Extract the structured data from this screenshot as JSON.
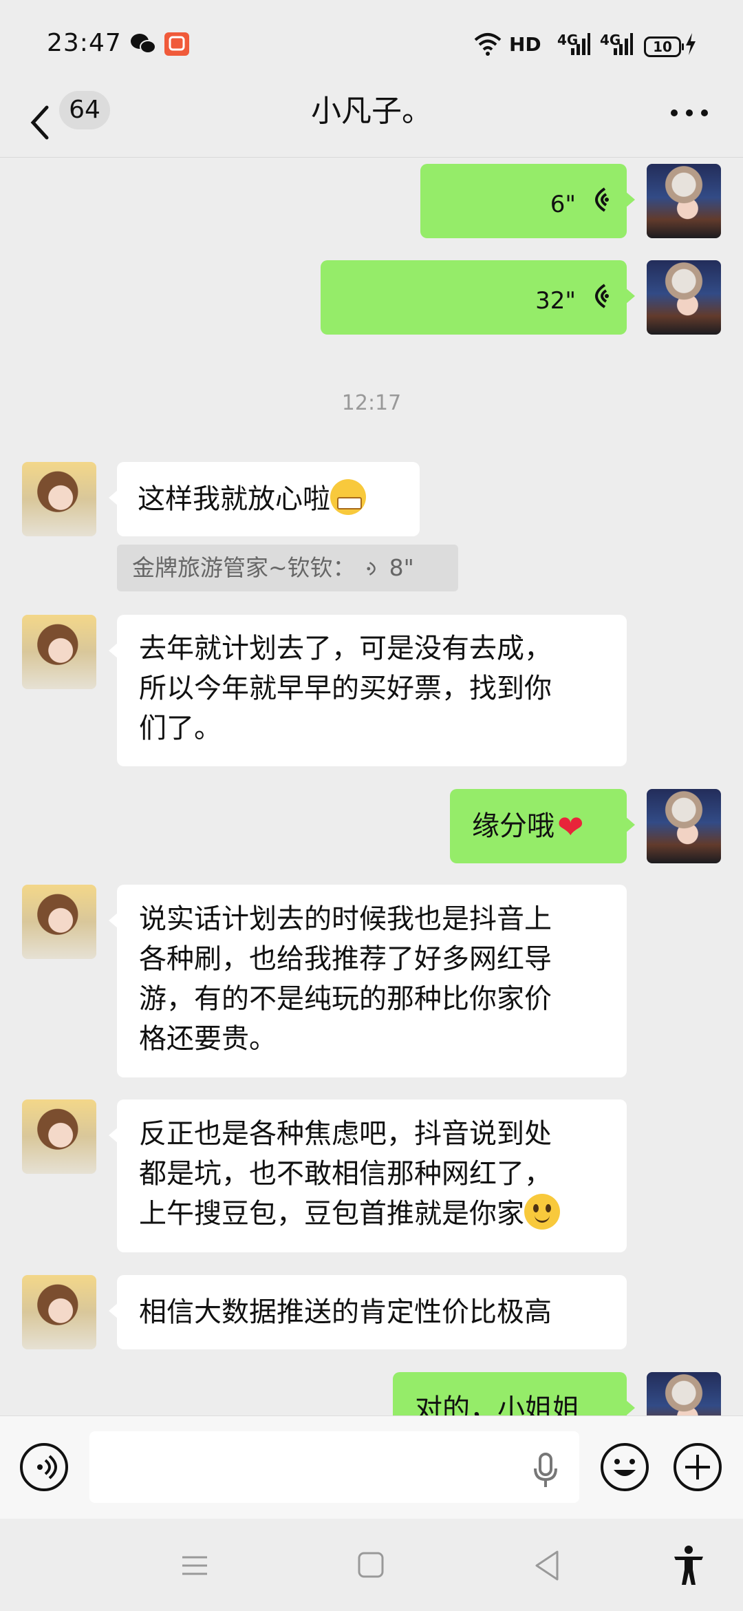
{
  "status_bar": {
    "time": "23:47",
    "network_label": "HD",
    "sim1_label": "4G",
    "sim2_label": "4G",
    "battery": "10",
    "icons": [
      "wechat-icon",
      "app-notification-icon",
      "wifi-icon",
      "signal-icon",
      "charging-icon"
    ]
  },
  "header": {
    "unread_count": "64",
    "title": "小凡子。",
    "icons": [
      "back-chevron-icon",
      "more-icon"
    ]
  },
  "messages": [
    {
      "sender": "me",
      "type": "voice",
      "duration": "6\""
    },
    {
      "sender": "me",
      "type": "voice",
      "duration": "32\""
    },
    {
      "type": "timestamp",
      "text": "12:17"
    },
    {
      "sender": "other",
      "type": "text",
      "text": "这样我就放心啦",
      "emoji": "grin-emoji"
    },
    {
      "type": "quote",
      "text": "金牌旅游管家~钦钦：",
      "duration": "8\""
    },
    {
      "sender": "other",
      "type": "text",
      "lines": [
        "去年就计划去了，可是没有去成，",
        "所以今年就早早的买好票，找到你",
        "们了。"
      ]
    },
    {
      "sender": "me",
      "type": "text",
      "text": "缘分哦",
      "emoji": "heart-emoji"
    },
    {
      "sender": "other",
      "type": "text",
      "lines": [
        "说实话计划去的时候我也是抖音上",
        "各种刷，也给我推荐了好多网红导",
        "游，有的不是纯玩的那种比你家价",
        "格还要贵。"
      ]
    },
    {
      "sender": "other",
      "type": "text",
      "lines": [
        "反正也是各种焦虑吧，抖音说到处",
        "都是坑，也不敢相信那种网红了，",
        "上午搜豆包，豆包首推就是你家"
      ],
      "emoji": "smile-emoji"
    },
    {
      "sender": "other",
      "type": "text",
      "text": "相信大数据推送的肯定性价比极高"
    },
    {
      "sender": "me",
      "type": "text",
      "text": "对的，小姐姐"
    }
  ],
  "input_bar": {
    "value": "",
    "icons": [
      "voice-mode-icon",
      "microphone-icon",
      "emoji-icon",
      "plus-icon"
    ]
  },
  "nav_bar": {
    "icons": [
      "menu-icon",
      "home-icon",
      "back-icon",
      "accessibility-icon"
    ]
  },
  "colors": {
    "background": "#ededed",
    "my_bubble": "#95ec69",
    "their_bubble": "#ffffff",
    "quote_bg": "#dcdcdc"
  }
}
